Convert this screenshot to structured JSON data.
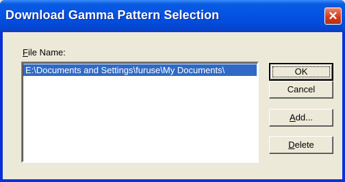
{
  "window": {
    "title": "Download Gamma Pattern Selection",
    "close_glyph": "✕"
  },
  "file_name_label": {
    "accel": "F",
    "rest": "ile Name:"
  },
  "file_list": {
    "items": [
      "E:\\Documents and Settings\\furuse\\My Documents\\"
    ],
    "selected_index": 0
  },
  "buttons": {
    "ok": {
      "accel": "",
      "label": "OK"
    },
    "cancel": {
      "label": "Cancel"
    },
    "add": {
      "accel": "A",
      "rest": "dd..."
    },
    "delete": {
      "accel": "D",
      "rest": "elete"
    }
  },
  "colors": {
    "title_bar": "#0452e4",
    "selection": "#316ac5",
    "face": "#ece9d8",
    "close_button": "#d23b1b"
  }
}
